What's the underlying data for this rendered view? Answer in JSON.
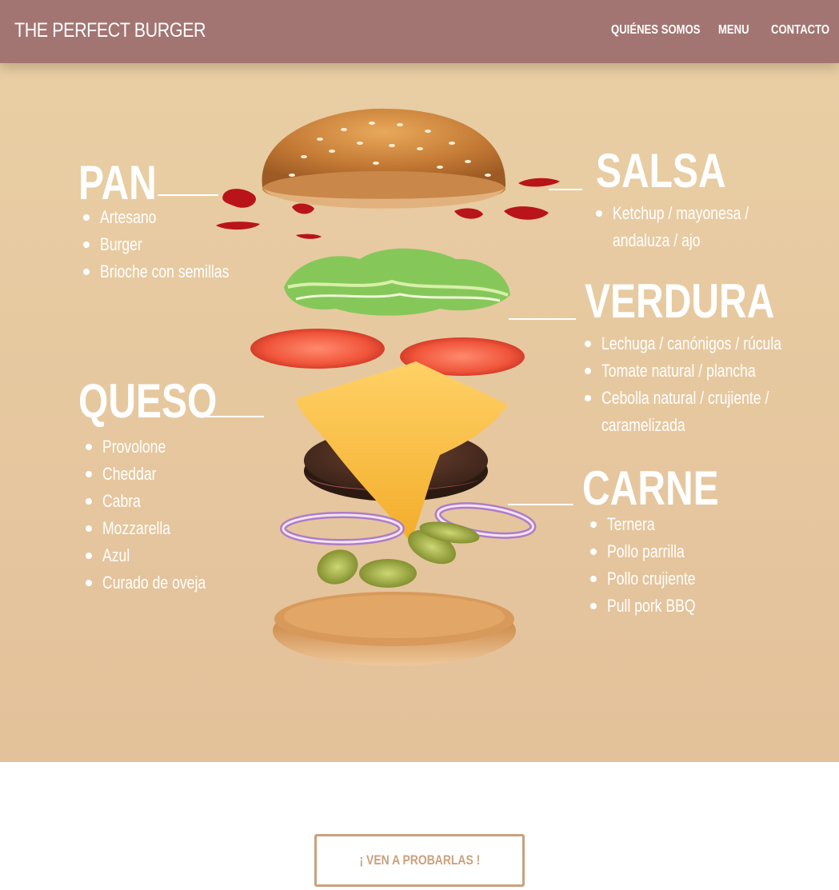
{
  "nav": {
    "brand": "THE PERFECT BURGER",
    "links": [
      "QUIÉNES SOMOS",
      "MENU",
      "CONTACTO"
    ]
  },
  "hero": {
    "pan": {
      "title": "PAN",
      "items": [
        "Artesano",
        "Burger",
        "Brioche con semillas"
      ]
    },
    "salsa": {
      "title": "SALSA",
      "items": [
        "Ketchup / mayonesa /",
        "andaluza / ajo"
      ]
    },
    "verdura": {
      "title": "VERDURA",
      "items": [
        "Lechuga / canónigos / rúcula",
        "Tomate natural / plancha",
        "Cebolla natural / crujiente /",
        "caramelizada"
      ]
    },
    "queso": {
      "title": "QUESO",
      "items": [
        "Provolone",
        "Cheddar",
        "Cabra",
        "Mozzarella",
        "Azul",
        "Curado de oveja"
      ]
    },
    "carne": {
      "title": "CARNE",
      "items": [
        "Ternera",
        "Pollo parrilla",
        "Pollo crujiente",
        "Pull pork BBQ"
      ]
    }
  },
  "cta": {
    "label": "¡ VEN A PROBARLAS !"
  },
  "colors": {
    "nav": "#a37572",
    "hero": "#e6c6a0",
    "accent": "#caa17c"
  }
}
